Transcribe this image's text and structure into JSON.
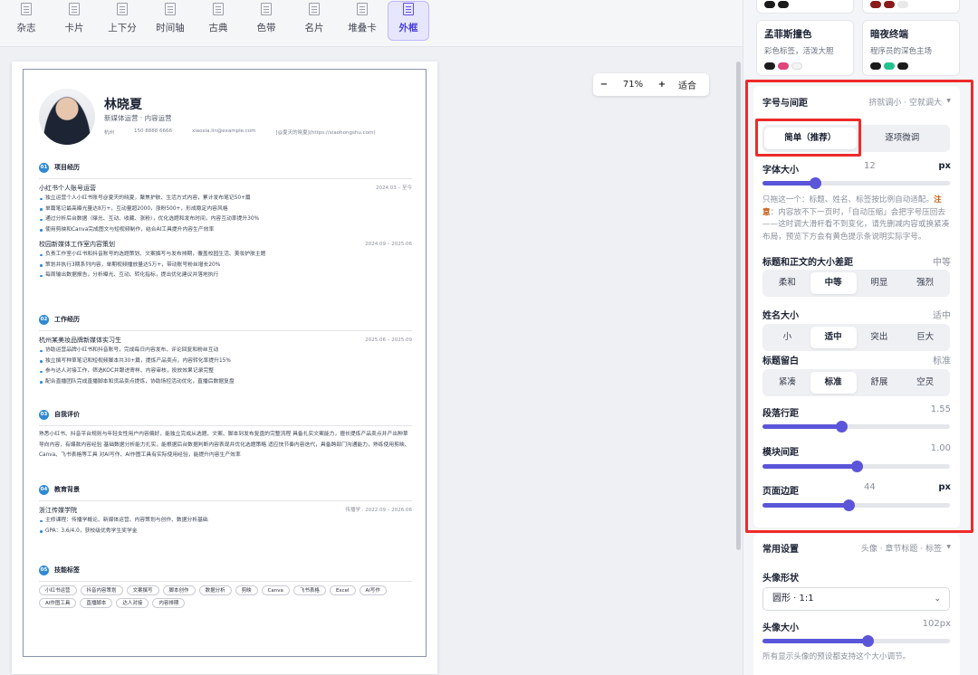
{
  "templates": [
    {
      "label": "杂志",
      "active": false
    },
    {
      "label": "卡片",
      "active": false
    },
    {
      "label": "上下分",
      "active": false
    },
    {
      "label": "时间轴",
      "active": false
    },
    {
      "label": "古典",
      "active": false
    },
    {
      "label": "色带",
      "active": false
    },
    {
      "label": "名片",
      "active": false
    },
    {
      "label": "堆叠卡",
      "active": false
    },
    {
      "label": "外框",
      "active": true
    }
  ],
  "zoom": {
    "minus": "−",
    "value": "71%",
    "plus": "+",
    "fit": "适合"
  },
  "resume": {
    "name": "林晓夏",
    "role": "新媒体运营 · 内容运营",
    "contact": [
      "杭州",
      "150 8888 6666",
      "xiaoxia.lin@example.com",
      "[@夏天的晓夏](https://xiaohongshu.com)"
    ],
    "sections": [
      {
        "no": "01",
        "title": "项目经历",
        "items": [
          {
            "title": "小红书个人账号运营",
            "date": "2024.03 – 至今",
            "bullets": [
              "独立运营个人小红书账号@夏天的晓夏，聚焦护肤、生活方式内容，累计发布笔记50+篇",
              "单篇笔记最高曝光量达8万+，互动量超2000，涨粉500+，形成稳定内容风格",
              "通过分析后台数据（曝光、互动、收藏、涨粉），优化选题和发布时间，内容互动率提升30%",
              "使用剪映和Canva完成图文与短视频制作，结合AI工具提升内容生产效率"
            ]
          },
          {
            "title": "校园新媒体工作室内容策划",
            "date": "2024.09 – 2025.06",
            "bullets": [
              "负责工作室小红书和抖音账号的选题策划、文案撰写与发布排期，覆盖校园生活、美妆护肤主题",
              "策划并执行3期系列内容，单期视频播放量达5万+，带动账号粉丝增长20%",
              "每周输出数据报告，分析曝光、互动、转化指标，提出优化建议并落地执行"
            ]
          }
        ]
      },
      {
        "no": "02",
        "title": "工作经历",
        "items": [
          {
            "title": "杭州某美妆品牌新媒体实习生",
            "date": "2025.06 – 2025.09",
            "bullets": [
              "协助运营品牌小红书和抖音账号，完成每日内容发布、评论回复和粉丝互动",
              "独立撰写种草笔记和短视频脚本共30+篇，提炼产品卖点，内容转化率提升15%",
              "参与达人对接工作，筛选KOC并跟进寄样、内容审核，投放效果记录完整",
              "配合直播团队完成直播脚本和货品卖点提炼，协助场控活动优化，直播后数据复盘"
            ]
          }
        ]
      },
      {
        "no": "03",
        "title": "自我评价",
        "paragraph": "熟悉小红书、抖音平台规则与年轻女性用户内容偏好，能独立完成从选题、文案、脚本到发布复盘的完整流程 具备扎实文案能力，擅长提炼产品卖点并产出种草导向内容，有爆款内容经验 基础数据分析能力扎实，能根据后台数据判断内容表现并优化选题策略 适应快节奏内容迭代，具备跨部门沟通能力，熟练使用剪映、Canva、飞书表格等工具 对AI写作、AI作图工具有实际使用经验，能提升内容生产效率"
      },
      {
        "no": "04",
        "title": "教育背景",
        "items": [
          {
            "title": "浙江传媒学院",
            "date": "传播学 · 2022.09 – 2026.06",
            "bullets": [
              "主修课程：传播学概论、新媒体运营、内容策划与创作、数据分析基础",
              "GPA：3.6/4.0，获校级优秀学生奖学金"
            ]
          }
        ]
      },
      {
        "no": "05",
        "title": "技能标签",
        "tags": [
          "小红书运营",
          "抖音内容策划",
          "文案撰写",
          "脚本创作",
          "数据分析",
          "剪映",
          "Canva",
          "飞书表格",
          "Excel",
          "AI写作",
          "AI作图工具",
          "直播脚本",
          "达人对接",
          "内容排期"
        ]
      }
    ]
  },
  "themes": [
    {
      "name": "孟菲斯撞色",
      "desc": "彩色标签，活泼大胆",
      "colors": [
        "#1b1b1b",
        "#e0457b",
        "#f4f4f4"
      ]
    },
    {
      "name": "暗夜终端",
      "desc": "程序员的深色主场",
      "colors": [
        "#1b1b1b",
        "#22c38e",
        "#1b1b1b"
      ]
    }
  ],
  "theme_top_colors": [
    [
      "#1b1b1b",
      "#1b1b1b"
    ],
    [
      "#8b1a1a",
      "#8b1a1a",
      "#e8e8e8"
    ]
  ],
  "typography": {
    "title": "字号与间距",
    "hint": "挤就调小 · 空就调大",
    "tabs": [
      {
        "label": "简单（推荐）",
        "active": true
      },
      {
        "label": "逐项微调",
        "active": false
      }
    ],
    "font_size": {
      "label": "字体大小",
      "value": "12",
      "unit": "px",
      "fraction": 0.28
    },
    "note_before": "只拖这一个：标题、姓名、标签按比例自动适配。",
    "note_bold": "注意",
    "note_after": "：内容放不下一页时，「自动压缩」会把字号压回去——这时调大滑杆看不到变化，请先删减内容或换紧凑布局，预览下方会有黄色提示条说明实际字号。",
    "contrast": {
      "label": "标题和正文的大小差距",
      "value": "中等",
      "options": [
        "柔和",
        "中等",
        "明显",
        "强烈"
      ],
      "selected": 1
    },
    "name_size": {
      "label": "姓名大小",
      "value": "适中",
      "options": [
        "小",
        "适中",
        "突出",
        "巨大"
      ],
      "selected": 1
    },
    "whitespace": {
      "label": "标题留白",
      "value": "标准",
      "options": [
        "紧凑",
        "标准",
        "舒展",
        "空灵"
      ],
      "selected": 1
    },
    "line_height": {
      "label": "段落行距",
      "value": "1.55",
      "fraction": 0.42
    },
    "block_gap": {
      "label": "模块间距",
      "value": "1.00",
      "fraction": 0.5
    },
    "page_margin": {
      "label": "页面边距",
      "value": "44",
      "unit": "px",
      "fraction": 0.46
    }
  },
  "common": {
    "title": "常用设置",
    "hint": "头像 · 章节标题 · 标签",
    "avatar_shape": {
      "label": "头像形状",
      "value": "圆形 · 1:1"
    },
    "avatar_size": {
      "label": "头像大小",
      "value": "102px",
      "fraction": 0.56
    },
    "note": "所有显示头像的预设都支持这个大小调节。"
  }
}
